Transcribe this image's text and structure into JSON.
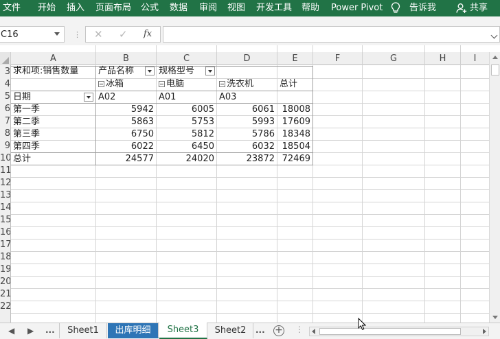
{
  "ribbon": {
    "tabs": [
      "文件",
      "开始",
      "插入",
      "页面布局",
      "公式",
      "数据",
      "审阅",
      "视图",
      "开发工具",
      "帮助",
      "Power Pivot"
    ],
    "tell_me": "告诉我",
    "share": "共享"
  },
  "formula_bar": {
    "name_box": "C16",
    "formula": ""
  },
  "columns": [
    "A",
    "B",
    "C",
    "D",
    "E",
    "F",
    "G",
    "H",
    "I"
  ],
  "rows": [
    "3",
    "4",
    "5",
    "6",
    "7",
    "8",
    "9",
    "10",
    "11",
    "12",
    "13",
    "14",
    "15",
    "16",
    "17",
    "18",
    "19",
    "20",
    "21",
    "22"
  ],
  "pivot": {
    "title": "求和项:销售数量",
    "field1": "产品名称",
    "field2": "规格型号",
    "products": [
      "冰箱",
      "电脑",
      "洗衣机"
    ],
    "total_label": "总计",
    "row_field": "日期",
    "codes": [
      "A02",
      "A01",
      "A03"
    ],
    "rows": [
      {
        "label": "第一季",
        "values": [
          "5942",
          "6005",
          "6061",
          "18008"
        ]
      },
      {
        "label": "第二季",
        "values": [
          "5863",
          "5753",
          "5993",
          "17609"
        ]
      },
      {
        "label": "第三季",
        "values": [
          "6750",
          "5812",
          "5786",
          "18348"
        ]
      },
      {
        "label": "第四季",
        "values": [
          "6022",
          "6450",
          "6032",
          "18504"
        ]
      }
    ],
    "grand_total": {
      "label": "总计",
      "values": [
        "24577",
        "24020",
        "23872",
        "72469"
      ]
    }
  },
  "sheet_tabs": {
    "nav_more": "...",
    "tabs": [
      "Sheet1",
      "出库明细",
      "Sheet3",
      "Sheet2"
    ],
    "active": "Sheet3",
    "more": "..."
  },
  "colors": {
    "ribbon": "#217346",
    "colored_tab": "#2e75b6"
  }
}
